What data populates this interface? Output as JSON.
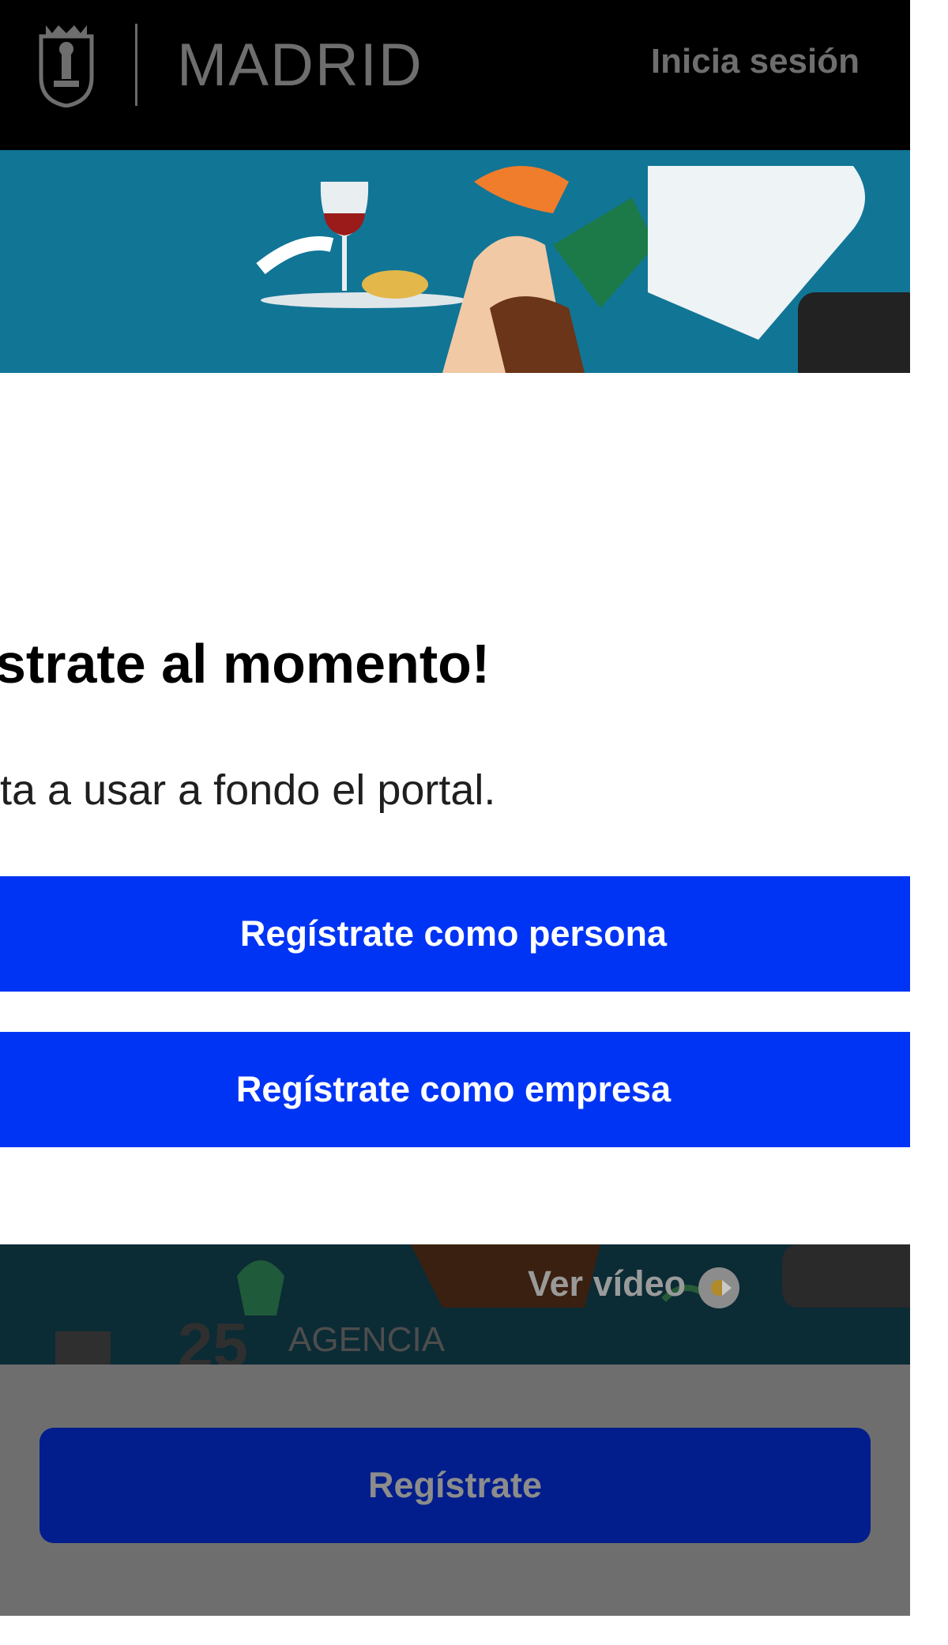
{
  "header": {
    "brand": "MADRID",
    "login_label": "Inicia sesión"
  },
  "modal": {
    "heading": "strate al momento!",
    "subtext": "ta a usar a fondo el portal.",
    "register_person_label": "Regístrate como persona",
    "register_company_label": "Regístrate como empresa"
  },
  "video": {
    "label": "Ver vídeo",
    "agency_number": "25",
    "agency_text": "AGENCIA"
  },
  "footer": {
    "register_label": "Regístrate"
  },
  "colors": {
    "primary_blue": "#0034f5",
    "dark_blue": "#021e8c",
    "overlay_grey": "#6e6e6e",
    "header_bg": "#000000"
  }
}
